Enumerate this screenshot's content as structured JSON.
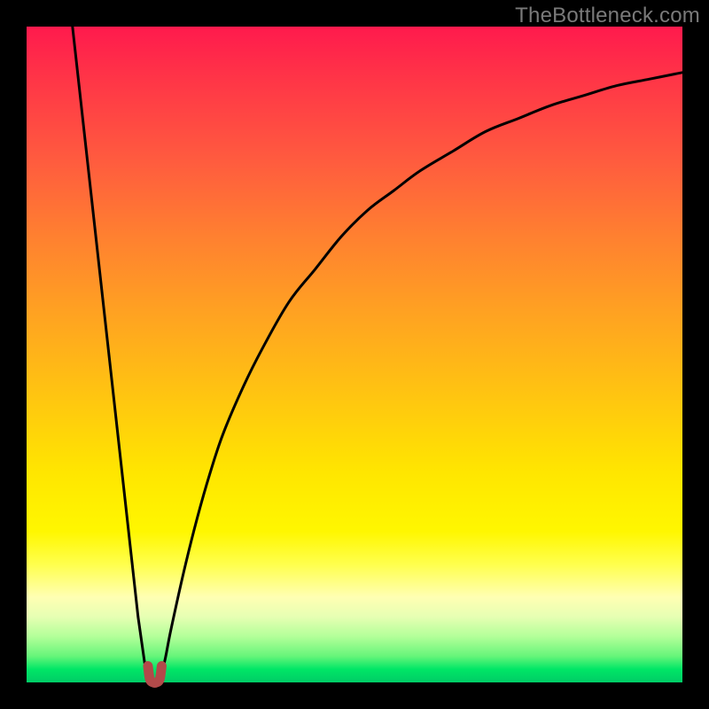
{
  "watermark": "TheBottleneck.com",
  "chart_data": {
    "type": "line",
    "title": "",
    "xlabel": "",
    "ylabel": "",
    "xlim": [
      0,
      100
    ],
    "ylim": [
      0,
      100
    ],
    "grid": false,
    "series": [
      {
        "name": "left-curve",
        "x": [
          7,
          8,
          9,
          10,
          11,
          12,
          13,
          14,
          15,
          16,
          17,
          18,
          18.5,
          19
        ],
        "y": [
          100,
          91,
          82,
          73,
          64,
          55,
          46,
          37,
          28,
          19,
          10,
          3,
          1,
          0
        ]
      },
      {
        "name": "valley-marker",
        "x": [
          18.5,
          18.8,
          19.3,
          19.8,
          20.3,
          20.6
        ],
        "y": [
          2.5,
          0.5,
          0,
          0,
          0.5,
          2.5
        ]
      },
      {
        "name": "right-curve",
        "x": [
          20,
          21,
          22,
          24,
          26,
          28,
          30,
          33,
          36,
          40,
          44,
          48,
          52,
          56,
          60,
          65,
          70,
          75,
          80,
          85,
          90,
          95,
          100
        ],
        "y": [
          0,
          3,
          8,
          17,
          25,
          32,
          38,
          45,
          51,
          58,
          63,
          68,
          72,
          75,
          78,
          81,
          84,
          86,
          88,
          89.5,
          91,
          92,
          93
        ]
      }
    ],
    "colors": {
      "curve": "#000000",
      "marker": "#b24a4a"
    }
  }
}
